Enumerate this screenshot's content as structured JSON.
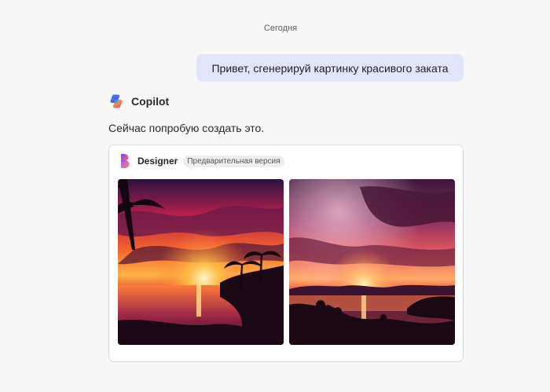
{
  "conversation": {
    "date_separator": "Сегодня",
    "user_message": "Привет, сгенерируй картинку красивого заката",
    "assistant": {
      "name": "Copilot",
      "message": "Сейчас попробую создать это."
    }
  },
  "designer_card": {
    "name": "Designer",
    "badge": "Предварительная версия",
    "images": [
      {
        "icon": "sunset-palms-image"
      },
      {
        "icon": "sunset-lake-image"
      }
    ]
  },
  "colors": {
    "user_bubble": "#e3e5fb",
    "background": "#f7f7f8",
    "card_border": "#dcdcdc"
  }
}
